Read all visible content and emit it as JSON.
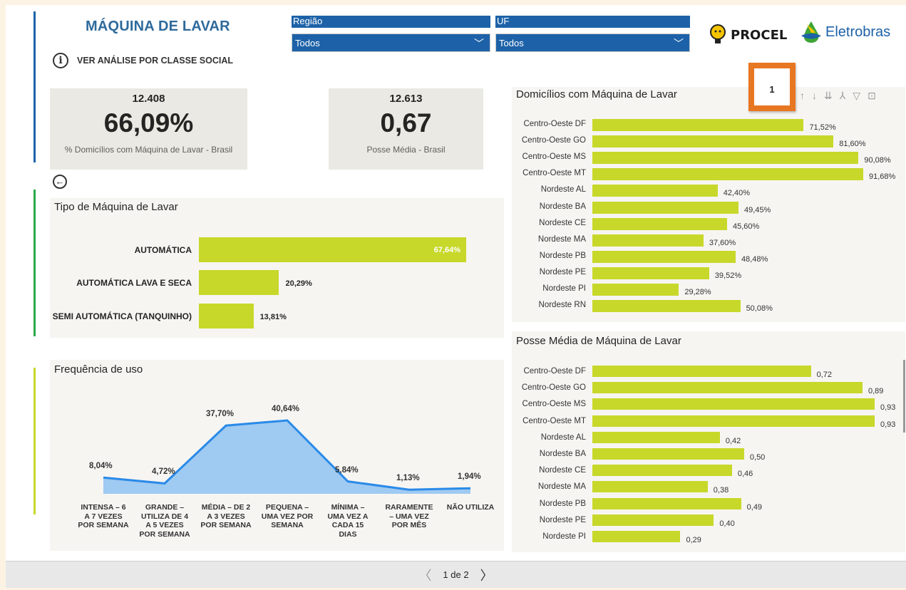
{
  "header": {
    "title": "MÁQUINA DE LAVAR",
    "info_link": "VER ANÁLISE POR CLASSE SOCIAL",
    "brand_procel": "PROCEL",
    "brand_eletrobras": "Eletrobras",
    "brand_colors": {
      "procel": "#1a1a1a",
      "eletrobras": "#1d62a8",
      "accent": "#c7d82a"
    }
  },
  "slicers": [
    {
      "label": "Região",
      "value": "Todos"
    },
    {
      "label": "UF",
      "value": "Todos"
    }
  ],
  "cards": [
    {
      "top": "12.408",
      "value": "66,09%",
      "label": "% Domicílios com Máquina de Lavar - Brasil"
    },
    {
      "top": "12.613",
      "value": "0,67",
      "label": "Posse Média - Brasil"
    }
  ],
  "tipo_chart": {
    "title": "Tipo de Máquina de Lavar",
    "categories": [
      "AUTOMÁTICA",
      "AUTOMÁTICA LAVA E SECA",
      "SEMI AUTOMÁTICA (TANQUINHO)"
    ],
    "values": [
      67.64,
      20.29,
      13.81
    ],
    "labels": [
      "67,64%",
      "20,29%",
      "13,81%"
    ]
  },
  "freq_chart": {
    "title": "Frequência de uso",
    "categories": [
      [
        "INTENSA – 6",
        "A 7 VEZES",
        "POR SEMANA"
      ],
      [
        "GRANDE –",
        "UTILIZA DE 4",
        "A 5 VEZES",
        "POR SEMANA"
      ],
      [
        "MÉDIA – DE 2",
        "A 3 VEZES",
        "POR SEMANA"
      ],
      [
        "PEQUENA –",
        "UMA VEZ POR",
        "SEMANA"
      ],
      [
        "MÍNIMA –",
        "UMA VEZ A",
        "CADA 15",
        "DIAS"
      ],
      [
        "RARAMENTE",
        "– UMA VEZ",
        "POR MÊS"
      ],
      [
        "NÃO UTILIZA"
      ]
    ],
    "values": [
      8.04,
      4.72,
      37.7,
      40.64,
      5.84,
      1.13,
      1.94
    ],
    "labels": [
      "8,04%",
      "4,72%",
      "37,70%",
      "40,64%",
      "5,84%",
      "1,13%",
      "1,94%"
    ]
  },
  "domicilios_chart": {
    "title": "Domicílios com Máquina de Lavar",
    "categories": [
      "Centro-Oeste DF",
      "Centro-Oeste GO",
      "Centro-Oeste MS",
      "Centro-Oeste MT",
      "Nordeste AL",
      "Nordeste BA",
      "Nordeste CE",
      "Nordeste MA",
      "Nordeste PB",
      "Nordeste PE",
      "Nordeste PI",
      "Nordeste RN"
    ],
    "values": [
      71.52,
      81.6,
      90.08,
      91.68,
      42.4,
      49.45,
      45.6,
      37.6,
      48.48,
      39.52,
      29.28,
      50.08
    ],
    "labels": [
      "71,52%",
      "81,60%",
      "90,08%",
      "91,68%",
      "42,40%",
      "49,45%",
      "45,60%",
      "37,60%",
      "48,48%",
      "39,52%",
      "29,28%",
      "50,08%"
    ]
  },
  "posse_chart": {
    "title": "Posse Média de Máquina de Lavar",
    "categories": [
      "Centro-Oeste DF",
      "Centro-Oeste GO",
      "Centro-Oeste MS",
      "Centro-Oeste MT",
      "Nordeste AL",
      "Nordeste BA",
      "Nordeste CE",
      "Nordeste MA",
      "Nordeste PB",
      "Nordeste PE",
      "Nordeste PI"
    ],
    "values": [
      0.72,
      0.89,
      0.93,
      0.93,
      0.42,
      0.5,
      0.46,
      0.38,
      0.49,
      0.4,
      0.29
    ],
    "labels": [
      "0,72",
      "0,89",
      "0,93",
      "0,93",
      "0,42",
      "0,50",
      "0,46",
      "0,38",
      "0,49",
      "0,40",
      "0,29"
    ]
  },
  "chart_data": [
    {
      "type": "bar",
      "title": "Tipo de Máquina de Lavar",
      "categories": [
        "AUTOMÁTICA",
        "AUTOMÁTICA LAVA E SECA",
        "SEMI AUTOMÁTICA (TANQUINHO)"
      ],
      "values": [
        67.64,
        20.29,
        13.81
      ]
    },
    {
      "type": "area",
      "title": "Frequência de uso",
      "categories": [
        "INTENSA – 6 A 7 VEZES POR SEMANA",
        "GRANDE – UTILIZA DE 4 A 5 VEZES POR SEMANA",
        "MÉDIA – DE 2 A 3 VEZES POR SEMANA",
        "PEQUENA – UMA VEZ POR SEMANA",
        "MÍNIMA – UMA VEZ A CADA 15 DIAS",
        "RARAMENTE – UMA VEZ POR MÊS",
        "NÃO UTILIZA"
      ],
      "values": [
        8.04,
        4.72,
        37.7,
        40.64,
        5.84,
        1.13,
        1.94
      ]
    },
    {
      "type": "bar",
      "title": "Domicílios com Máquina de Lavar",
      "categories": [
        "Centro-Oeste DF",
        "Centro-Oeste GO",
        "Centro-Oeste MS",
        "Centro-Oeste MT",
        "Nordeste AL",
        "Nordeste BA",
        "Nordeste CE",
        "Nordeste MA",
        "Nordeste PB",
        "Nordeste PE",
        "Nordeste PI",
        "Nordeste RN"
      ],
      "values": [
        71.52,
        81.6,
        90.08,
        91.68,
        42.4,
        49.45,
        45.6,
        37.6,
        48.48,
        39.52,
        29.28,
        50.08
      ]
    },
    {
      "type": "bar",
      "title": "Posse Média de Máquina de Lavar",
      "categories": [
        "Centro-Oeste DF",
        "Centro-Oeste GO",
        "Centro-Oeste MS",
        "Centro-Oeste MT",
        "Nordeste AL",
        "Nordeste BA",
        "Nordeste CE",
        "Nordeste MA",
        "Nordeste PB",
        "Nordeste PE",
        "Nordeste PI"
      ],
      "values": [
        0.72,
        0.89,
        0.93,
        0.93,
        0.42,
        0.5,
        0.46,
        0.38,
        0.49,
        0.4,
        0.29
      ]
    }
  ],
  "badge": "1",
  "pager": {
    "text": "1 de 2",
    "prev": "〈",
    "next": "〉"
  }
}
